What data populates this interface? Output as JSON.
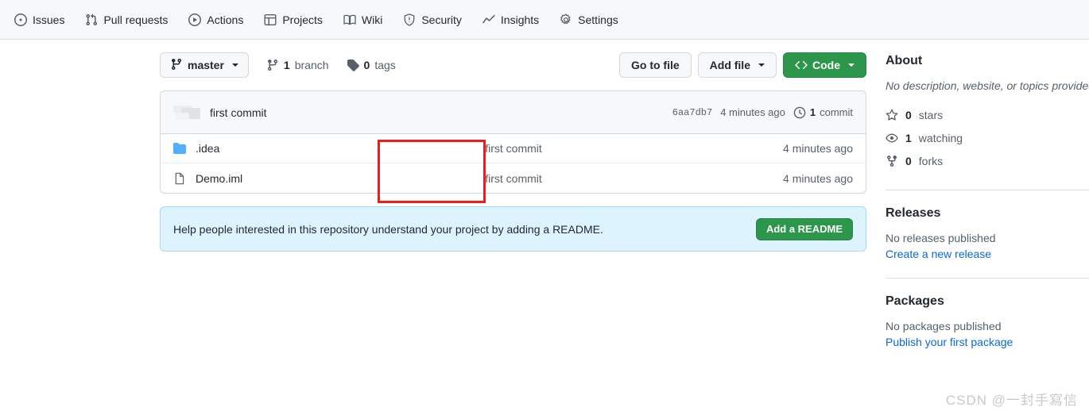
{
  "repo_nav": {
    "items": [
      {
        "label": "Issues",
        "icon": "issue-opened-icon"
      },
      {
        "label": "Pull requests",
        "icon": "git-pull-request-icon"
      },
      {
        "label": "Actions",
        "icon": "play-icon"
      },
      {
        "label": "Projects",
        "icon": "table-icon"
      },
      {
        "label": "Wiki",
        "icon": "book-icon"
      },
      {
        "label": "Security",
        "icon": "shield-icon"
      },
      {
        "label": "Insights",
        "icon": "graph-icon"
      },
      {
        "label": "Settings",
        "icon": "gear-icon"
      }
    ]
  },
  "branch_bar": {
    "current_branch": "master",
    "branch_count": "1",
    "branch_label": "branch",
    "tag_count": "0",
    "tag_label": "tags",
    "go_to_file": "Go to file",
    "add_file": "Add file",
    "code": "Code"
  },
  "commit_bar": {
    "message": "first commit",
    "sha": "6aa7db7",
    "time": "4 minutes ago",
    "commit_count": "1",
    "commit_count_label": "commit"
  },
  "files": [
    {
      "name": ".idea",
      "icon": "folder-icon",
      "message": "first commit",
      "time": "4 minutes ago"
    },
    {
      "name": "Demo.iml",
      "icon": "file-icon",
      "message": "first commit",
      "time": "4 minutes ago"
    }
  ],
  "readme_banner": {
    "text": "Help people interested in this repository understand your project by adding a README.",
    "button": "Add a README"
  },
  "sidebar": {
    "about_title": "About",
    "about_description": "No description, website, or topics provided.",
    "stats": [
      {
        "count": "0",
        "label": "stars",
        "icon": "star-icon"
      },
      {
        "count": "1",
        "label": "watching",
        "icon": "eye-icon"
      },
      {
        "count": "0",
        "label": "forks",
        "icon": "repo-forked-icon"
      }
    ],
    "releases_title": "Releases",
    "releases_empty": "No releases published",
    "releases_link": "Create a new release",
    "packages_title": "Packages",
    "packages_empty": "No packages published",
    "packages_link": "Publish your first package"
  },
  "annotation": {
    "color": "#ee1c1c"
  },
  "watermark": {
    "text": "CSDN @一封手寫信"
  },
  "colors": {
    "green": "#2c974b",
    "link": "#0969da",
    "banner_bg": "#ddf4ff",
    "nav_bg": "#f6f8fa"
  }
}
